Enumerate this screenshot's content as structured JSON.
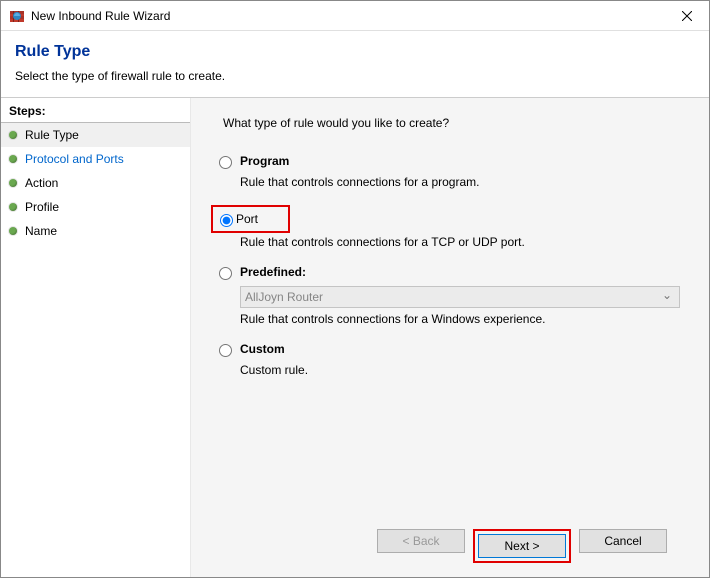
{
  "window": {
    "title": "New Inbound Rule Wizard"
  },
  "header": {
    "heading": "Rule Type",
    "subtitle": "Select the type of firewall rule to create."
  },
  "sidebar": {
    "heading": "Steps:",
    "items": [
      {
        "label": "Rule Type",
        "active": true,
        "link": false
      },
      {
        "label": "Protocol and Ports",
        "active": false,
        "link": true
      },
      {
        "label": "Action",
        "active": false,
        "link": false
      },
      {
        "label": "Profile",
        "active": false,
        "link": false
      },
      {
        "label": "Name",
        "active": false,
        "link": false
      }
    ]
  },
  "content": {
    "prompt": "What type of rule would you like to create?",
    "options": {
      "program": {
        "label": "Program",
        "desc": "Rule that controls connections for a program."
      },
      "port": {
        "label": "Port",
        "desc": "Rule that controls connections for a TCP or UDP port."
      },
      "predefined": {
        "label": "Predefined:",
        "desc": "Rule that controls connections for a Windows experience.",
        "selected": "AllJoyn Router"
      },
      "custom": {
        "label": "Custom",
        "desc": "Custom rule."
      }
    }
  },
  "footer": {
    "back": "< Back",
    "next": "Next >",
    "cancel": "Cancel"
  }
}
